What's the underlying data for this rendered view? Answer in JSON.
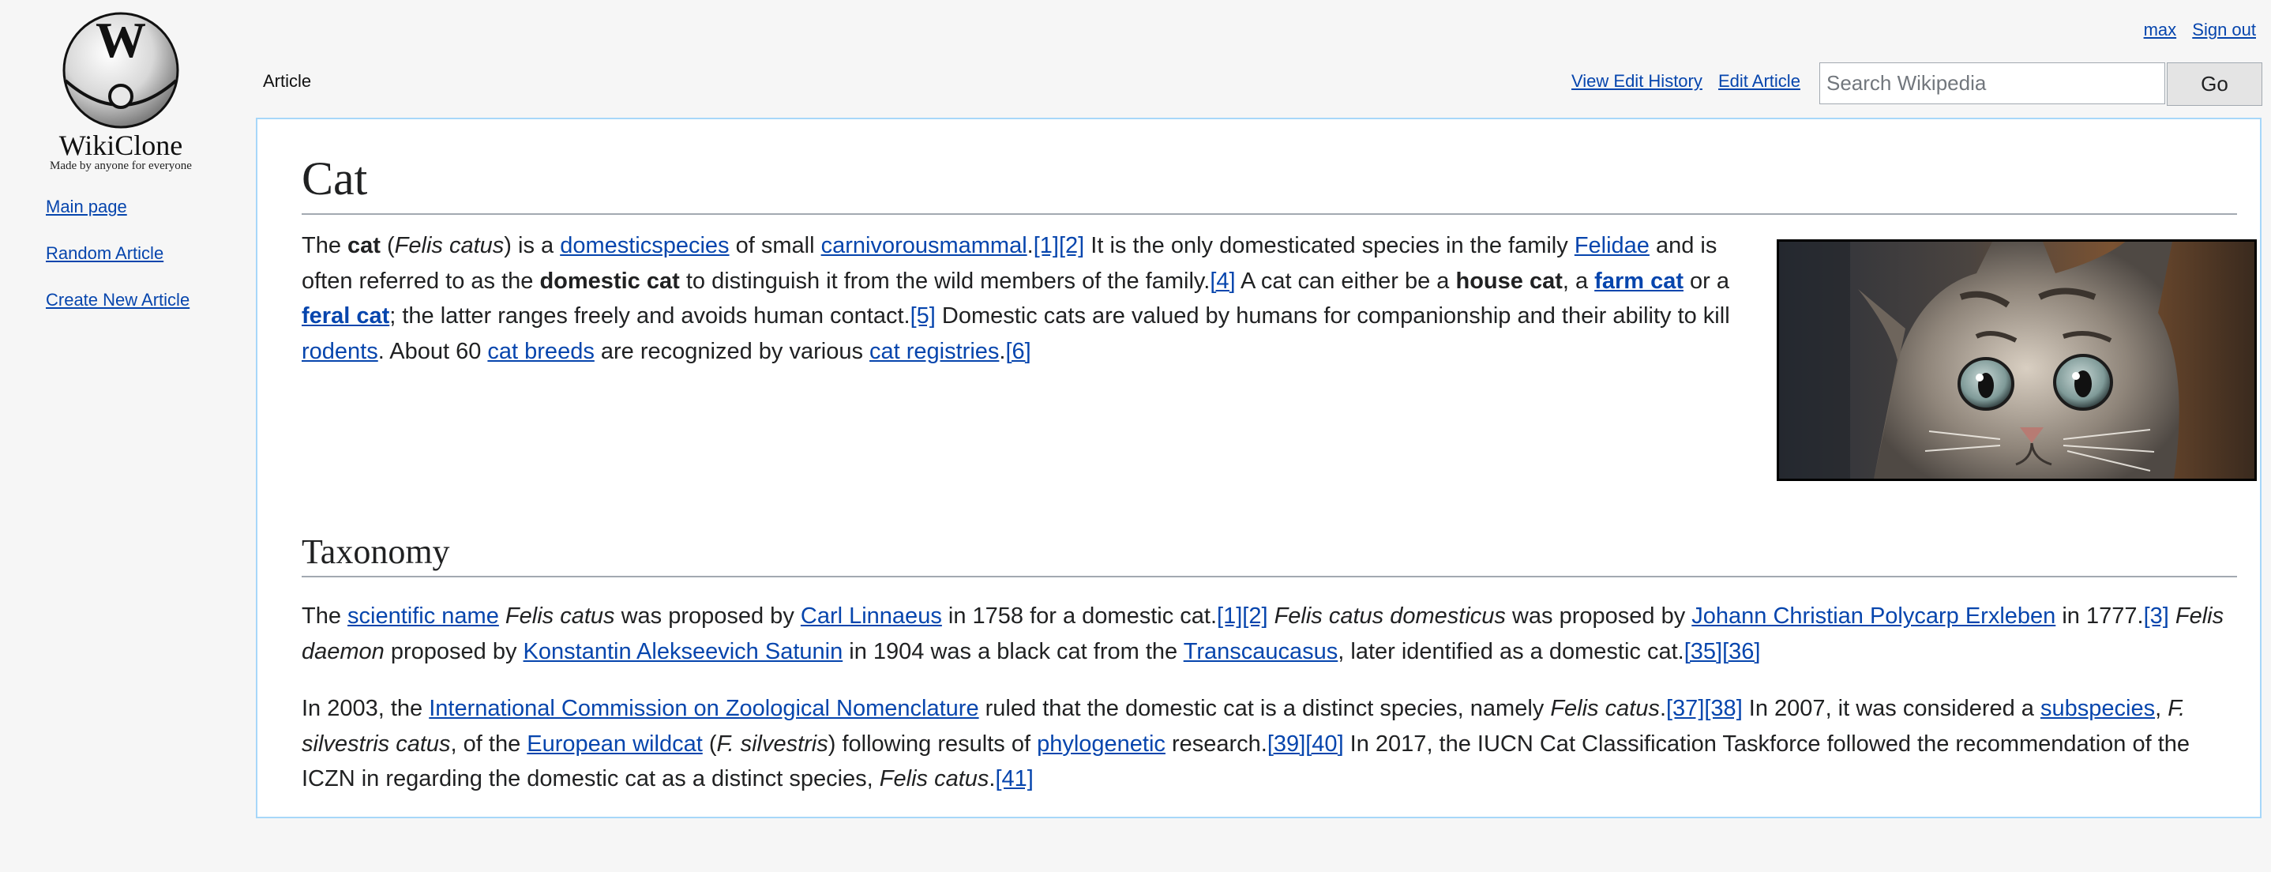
{
  "logo": {
    "title": "WikiClone",
    "tagline": "Made by anyone for everyone",
    "glyph": "W"
  },
  "sidebar": {
    "items": [
      {
        "label": "Main page"
      },
      {
        "label": "Random Article"
      },
      {
        "label": "Create New Article"
      }
    ]
  },
  "personal": {
    "username": "max",
    "signout": "Sign out"
  },
  "tabs": {
    "article": "Article",
    "view_history": "View Edit History",
    "edit": "Edit Article"
  },
  "search": {
    "placeholder": "Search Wikipedia",
    "value": "",
    "go_label": "Go"
  },
  "article": {
    "title": "Cat",
    "image_alt": "tabby kitten",
    "intro": [
      {
        "t": " The "
      },
      {
        "t": "cat",
        "b": true
      },
      {
        "t": " ("
      },
      {
        "t": "Felis catus",
        "i": true
      },
      {
        "t": ") is a "
      },
      {
        "t": "domesticspecies",
        "link": true
      },
      {
        "t": " of small "
      },
      {
        "t": "carnivorousmammal",
        "link": true
      },
      {
        "t": "."
      },
      {
        "t": "[1]",
        "link": true,
        "ref": true
      },
      {
        "t": "[2]",
        "link": true,
        "ref": true
      },
      {
        "t": " It is the only domesticated species in the family "
      },
      {
        "t": "Felidae",
        "link": true
      },
      {
        "t": " and is often referred to as the "
      },
      {
        "t": "domestic cat",
        "b": true
      },
      {
        "t": " to distinguish it from the wild members of the family."
      },
      {
        "t": "[4]",
        "link": true,
        "ref": true
      },
      {
        "t": " A cat can either be a "
      },
      {
        "t": "house cat",
        "b": true
      },
      {
        "t": ", a "
      },
      {
        "t": "farm cat",
        "link": true,
        "b": true
      },
      {
        "t": " or a "
      },
      {
        "t": "feral cat",
        "link": true,
        "b": true
      },
      {
        "t": "; the latter ranges freely and avoids human contact."
      },
      {
        "t": "[5]",
        "link": true,
        "ref": true
      },
      {
        "t": " Domestic cats are valued by humans for companionship and their ability to kill "
      },
      {
        "t": "rodents",
        "link": true
      },
      {
        "t": ". About 60 "
      },
      {
        "t": "cat breeds",
        "link": true
      },
      {
        "t": " are recognized by various "
      },
      {
        "t": "cat registries",
        "link": true
      },
      {
        "t": "."
      },
      {
        "t": "[6]",
        "link": true,
        "ref": true
      }
    ],
    "sections": [
      {
        "heading": "Taxonomy",
        "paragraphs": [
          [
            {
              "t": "The "
            },
            {
              "t": "scientific name",
              "link": true
            },
            {
              "t": " "
            },
            {
              "t": "Felis catus",
              "i": true
            },
            {
              "t": " was proposed by "
            },
            {
              "t": "Carl Linnaeus",
              "link": true
            },
            {
              "t": " in 1758 for a domestic cat."
            },
            {
              "t": "[1]",
              "link": true,
              "ref": true
            },
            {
              "t": "[2]",
              "link": true,
              "ref": true
            },
            {
              "t": " "
            },
            {
              "t": "Felis catus domesticus",
              "i": true
            },
            {
              "t": " was proposed by "
            },
            {
              "t": "Johann Christian Polycarp Erxleben",
              "link": true
            },
            {
              "t": " in 1777."
            },
            {
              "t": "[3]",
              "link": true,
              "ref": true
            },
            {
              "t": " "
            },
            {
              "t": "Felis daemon",
              "i": true
            },
            {
              "t": " proposed by "
            },
            {
              "t": "Konstantin Alekseevich Satunin",
              "link": true
            },
            {
              "t": " in 1904 was a black cat from the "
            },
            {
              "t": "Transcaucasus",
              "link": true
            },
            {
              "t": ", later identified as a domestic cat."
            },
            {
              "t": "[35]",
              "link": true,
              "ref": true
            },
            {
              "t": "[36]",
              "link": true,
              "ref": true
            }
          ],
          [
            {
              "t": "In 2003, the "
            },
            {
              "t": "International Commission on Zoological Nomenclature",
              "link": true
            },
            {
              "t": " ruled that the domestic cat is a distinct species, namely "
            },
            {
              "t": "Felis catus",
              "i": true
            },
            {
              "t": "."
            },
            {
              "t": "[37]",
              "link": true,
              "ref": true
            },
            {
              "t": "[38]",
              "link": true,
              "ref": true
            },
            {
              "t": " In 2007, it was considered a "
            },
            {
              "t": "subspecies",
              "link": true
            },
            {
              "t": ", "
            },
            {
              "t": "F. silvestris catus",
              "i": true
            },
            {
              "t": ", of the "
            },
            {
              "t": "European wildcat",
              "link": true
            },
            {
              "t": " ("
            },
            {
              "t": "F. silvestris",
              "i": true
            },
            {
              "t": ") following results of "
            },
            {
              "t": "phylogenetic",
              "link": true
            },
            {
              "t": " research."
            },
            {
              "t": "[39]",
              "link": true,
              "ref": true
            },
            {
              "t": "[40]",
              "link": true,
              "ref": true
            },
            {
              "t": " In 2017, the IUCN Cat Classification Taskforce followed the recommendation of the ICZN in regarding the domestic cat as a distinct species, "
            },
            {
              "t": "Felis catus",
              "i": true
            },
            {
              "t": "."
            },
            {
              "t": "[41]",
              "link": true,
              "ref": true
            }
          ]
        ]
      }
    ]
  },
  "colors": {
    "link": "#0645ad",
    "content_border": "#a7d7f9",
    "background": "#f6f6f6"
  }
}
